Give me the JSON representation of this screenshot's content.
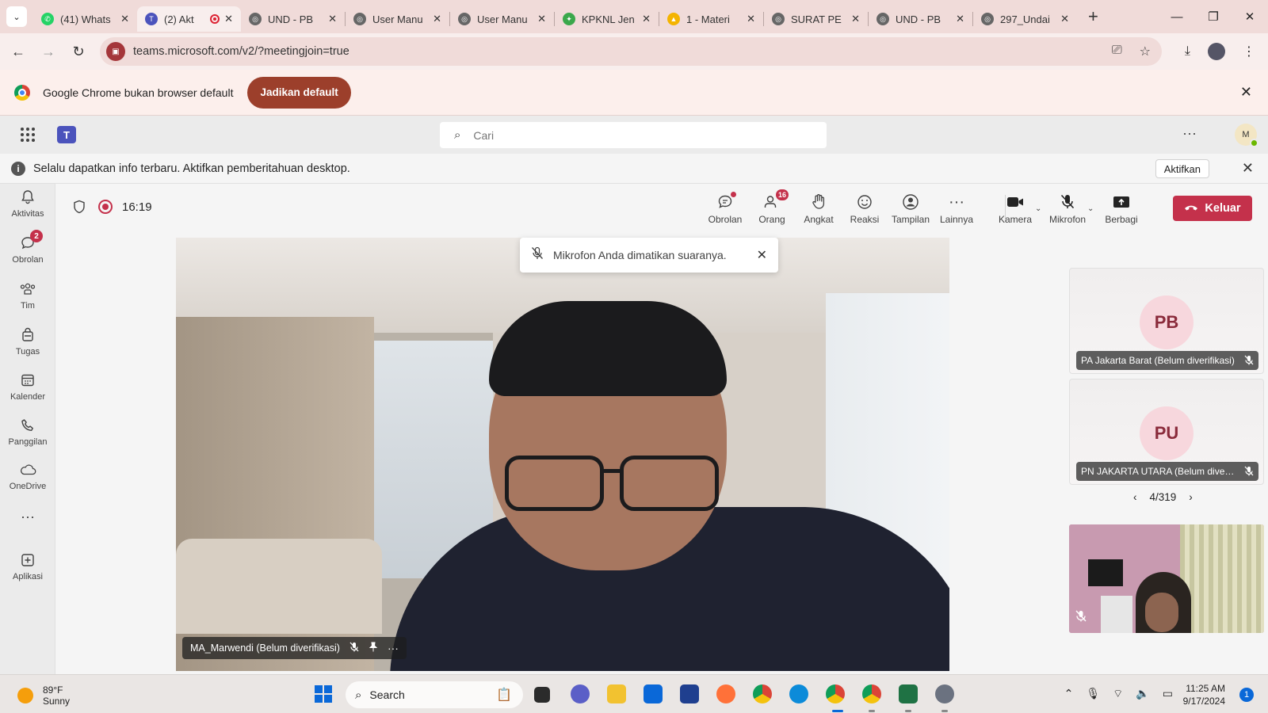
{
  "browser": {
    "tabs": [
      {
        "title": "(41) Whats",
        "favicon": "whatsapp-icon",
        "color": "#25d366",
        "badge": "41"
      },
      {
        "title": "(2) Akt",
        "favicon": "teams-icon",
        "color": "#4b53bc",
        "active": true,
        "recording": true
      },
      {
        "title": "UND - PB",
        "favicon": "globe-icon",
        "color": "#666666"
      },
      {
        "title": "User Manu",
        "favicon": "globe-icon",
        "color": "#666666"
      },
      {
        "title": "User Manu",
        "favicon": "globe-icon",
        "color": "#666666"
      },
      {
        "title": "KPKNL Jen",
        "favicon": "leaf-icon",
        "color": "#3aa84b"
      },
      {
        "title": "1 - Materi",
        "favicon": "drive-icon",
        "color": "#f4b400"
      },
      {
        "title": "SURAT PE",
        "favicon": "globe-icon",
        "color": "#666666"
      },
      {
        "title": "UND - PB",
        "favicon": "globe-icon",
        "color": "#666666"
      },
      {
        "title": "297_Undai",
        "favicon": "globe-icon",
        "color": "#666666"
      }
    ],
    "url": "teams.microsoft.com/v2/?meetingjoin=true",
    "infobar": {
      "message": "Google Chrome bukan browser default",
      "button": "Jadikan default"
    }
  },
  "teams": {
    "search_placeholder": "Cari",
    "avatar_initial": "M",
    "notification": {
      "message": "Selalu dapatkan info terbaru. Aktifkan pemberitahuan desktop.",
      "button": "Aktifkan"
    },
    "rail": [
      {
        "label": "Aktivitas",
        "icon": "bell-icon"
      },
      {
        "label": "Obrolan",
        "icon": "chat-icon",
        "badge": "2"
      },
      {
        "label": "Tim",
        "icon": "teams-people-icon"
      },
      {
        "label": "Tugas",
        "icon": "tasks-icon"
      },
      {
        "label": "Kalender",
        "icon": "calendar-icon"
      },
      {
        "label": "Panggilan",
        "icon": "phone-icon"
      },
      {
        "label": "OneDrive",
        "icon": "cloud-icon"
      },
      {
        "label": "Aplikasi",
        "icon": "add-apps-icon"
      }
    ]
  },
  "meeting": {
    "timer": "16:19",
    "toolbar": {
      "obrolan": "Obrolan",
      "orang": "Orang",
      "orang_badge": "16",
      "angkat": "Angkat",
      "reaksi": "Reaksi",
      "tampilan": "Tampilan",
      "lainnya": "Lainnya",
      "kamera": "Kamera",
      "mikrofon": "Mikrofon",
      "berbagi": "Berbagi",
      "keluar": "Keluar"
    },
    "toast": "Mikrofon Anda dimatikan suaranya.",
    "main_participant": "MA_Marwendi (Belum diverifikasi)",
    "tiles": [
      {
        "initials": "PB",
        "name": "PA Jakarta Barat (Belum diverifikasi)"
      },
      {
        "initials": "PU",
        "name": "PN JAKARTA UTARA (Belum diverifikasi)"
      }
    ],
    "pager": "4/319"
  },
  "taskbar": {
    "temperature": "89°F",
    "condition": "Sunny",
    "search": "Search",
    "time": "11:25 AM",
    "date": "9/17/2024",
    "notification_count": "1"
  },
  "colors": {
    "accent": "#4b53bc",
    "leave": "#c4314b",
    "infobar_button": "#9c3f2b"
  }
}
